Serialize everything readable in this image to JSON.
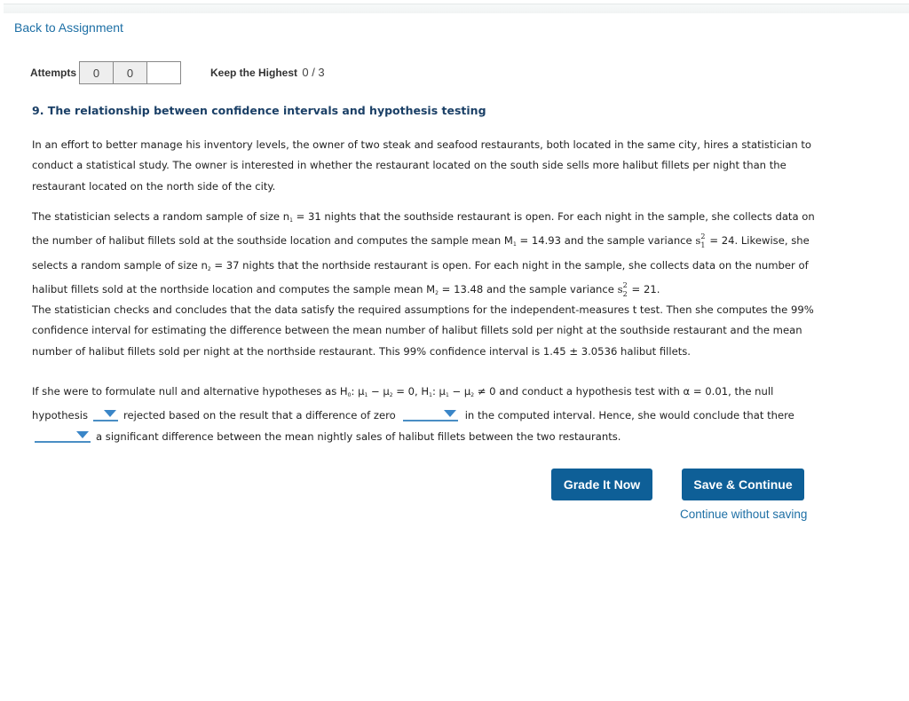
{
  "nav": {
    "back_label": "Back to Assignment"
  },
  "attempts": {
    "label": "Attempts",
    "boxes": [
      "0",
      "0",
      ""
    ]
  },
  "grading": {
    "policy_label": "Keep the Highest",
    "score": "0 / 3"
  },
  "question": {
    "title": "9. The relationship between confidence intervals and hypothesis testing",
    "p1": "In an effort to better manage his inventory levels, the owner of two steak and seafood restaurants, both located in the same city, hires a statistician to conduct a statistical study. The owner is interested in whether the restaurant located on the south side sells more halibut fillets per night than the restaurant located on the north side of the city.",
    "p2": {
      "a": "The statistician selects a random sample of size n",
      "sub1": "1",
      "b": " = 31 nights that the southside restaurant is open. For each night in the sample, she collects data on the number of halibut fillets sold at the southside location and computes the sample mean M",
      "sub2": "1",
      "c": " = 14.93 and the sample variance ",
      "var1_sup": "2",
      "var1_sub": "1",
      "d": "= 24. Likewise, she selects a random sample of size n",
      "sub3": "2",
      "e": " = 37 nights that the northside restaurant is open. For each night in the sample, she collects data on the number of halibut fillets sold at the northside location and computes the sample mean M",
      "sub4": "2",
      "f": " = 13.48 and the sample variance ",
      "var2_sup": "2",
      "var2_sub": "2",
      "g": "= 21."
    },
    "p3": "The statistician checks and concludes that the data satisfy the required assumptions for the independent-measures t test. Then she computes the 99% confidence interval for estimating the difference between the mean number of halibut fillets sold per night at the southside restaurant and the mean number of halibut fillets sold per night at the northside restaurant. This 99% confidence interval is 1.45 ± 3.0536 halibut fillets.",
    "p4": {
      "a": "If she were to formulate null and alternative hypotheses as H",
      "h0": "0",
      "b": ": μ",
      "m1": "1",
      "c": " − μ",
      "m2": "2",
      "d": " = 0, H",
      "h1": "1",
      "e": ": μ",
      "m3": "1",
      "f": " − μ",
      "m4": "2",
      "g": " ≠ 0 and conduct a hypothesis test with α = 0.01, the null hypothesis",
      "h": "rejected based on the result that a difference of zero",
      "i": "in the computed interval. Hence, she would conclude that there",
      "j": "a significant difference between the mean nightly sales of halibut fillets between the two restaurants."
    },
    "dropdowns": [
      {
        "selected": ""
      },
      {
        "selected": ""
      },
      {
        "selected": ""
      }
    ]
  },
  "actions": {
    "grade_label": "Grade It Now",
    "save_label": "Save & Continue",
    "continue_label": "Continue without saving"
  }
}
